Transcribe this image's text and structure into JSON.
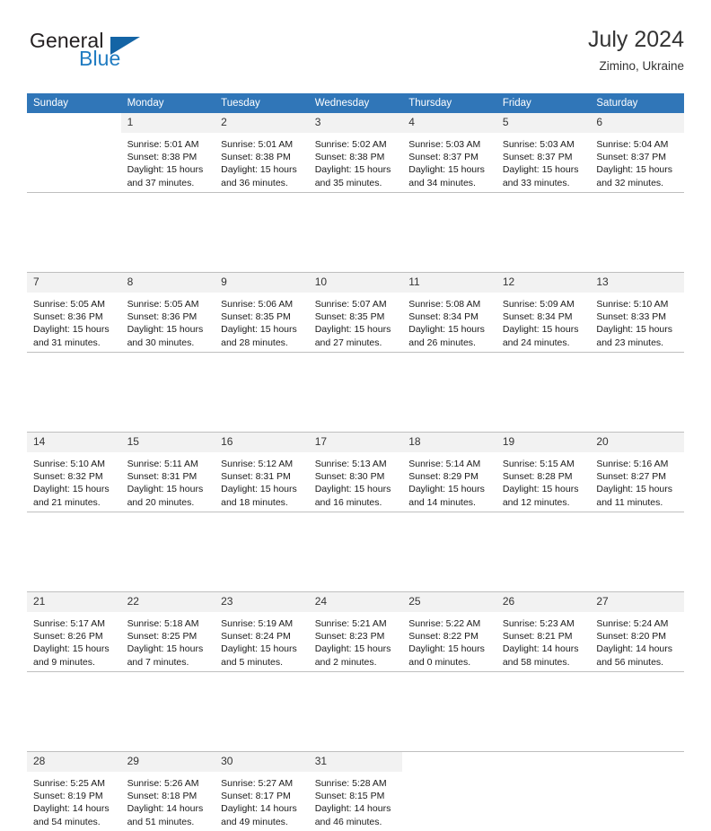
{
  "brand": {
    "name_part1": "General",
    "name_part2": "Blue",
    "logo_icon": "triangle-flag-icon"
  },
  "header": {
    "title": "July 2024",
    "subtitle": "Zimino, Ukraine"
  },
  "calendar": {
    "weekday_headers": [
      "Sunday",
      "Monday",
      "Tuesday",
      "Wednesday",
      "Thursday",
      "Friday",
      "Saturday"
    ],
    "colors": {
      "header_bg": "#3076b8",
      "header_text": "#ffffff",
      "daynum_bg": "#f2f2f2",
      "cell_border": "#bfbfbf",
      "brand_blue": "#1f7bc1",
      "logo_blue": "#1464a5"
    },
    "weeks": [
      [
        {
          "day": "",
          "empty": true
        },
        {
          "day": "1",
          "sunrise": "Sunrise: 5:01 AM",
          "sunset": "Sunset: 8:38 PM",
          "daylight_line1": "Daylight: 15 hours",
          "daylight_line2": "and 37 minutes."
        },
        {
          "day": "2",
          "sunrise": "Sunrise: 5:01 AM",
          "sunset": "Sunset: 8:38 PM",
          "daylight_line1": "Daylight: 15 hours",
          "daylight_line2": "and 36 minutes."
        },
        {
          "day": "3",
          "sunrise": "Sunrise: 5:02 AM",
          "sunset": "Sunset: 8:38 PM",
          "daylight_line1": "Daylight: 15 hours",
          "daylight_line2": "and 35 minutes."
        },
        {
          "day": "4",
          "sunrise": "Sunrise: 5:03 AM",
          "sunset": "Sunset: 8:37 PM",
          "daylight_line1": "Daylight: 15 hours",
          "daylight_line2": "and 34 minutes."
        },
        {
          "day": "5",
          "sunrise": "Sunrise: 5:03 AM",
          "sunset": "Sunset: 8:37 PM",
          "daylight_line1": "Daylight: 15 hours",
          "daylight_line2": "and 33 minutes."
        },
        {
          "day": "6",
          "sunrise": "Sunrise: 5:04 AM",
          "sunset": "Sunset: 8:37 PM",
          "daylight_line1": "Daylight: 15 hours",
          "daylight_line2": "and 32 minutes."
        }
      ],
      [
        {
          "day": "7",
          "sunrise": "Sunrise: 5:05 AM",
          "sunset": "Sunset: 8:36 PM",
          "daylight_line1": "Daylight: 15 hours",
          "daylight_line2": "and 31 minutes."
        },
        {
          "day": "8",
          "sunrise": "Sunrise: 5:05 AM",
          "sunset": "Sunset: 8:36 PM",
          "daylight_line1": "Daylight: 15 hours",
          "daylight_line2": "and 30 minutes."
        },
        {
          "day": "9",
          "sunrise": "Sunrise: 5:06 AM",
          "sunset": "Sunset: 8:35 PM",
          "daylight_line1": "Daylight: 15 hours",
          "daylight_line2": "and 28 minutes."
        },
        {
          "day": "10",
          "sunrise": "Sunrise: 5:07 AM",
          "sunset": "Sunset: 8:35 PM",
          "daylight_line1": "Daylight: 15 hours",
          "daylight_line2": "and 27 minutes."
        },
        {
          "day": "11",
          "sunrise": "Sunrise: 5:08 AM",
          "sunset": "Sunset: 8:34 PM",
          "daylight_line1": "Daylight: 15 hours",
          "daylight_line2": "and 26 minutes."
        },
        {
          "day": "12",
          "sunrise": "Sunrise: 5:09 AM",
          "sunset": "Sunset: 8:34 PM",
          "daylight_line1": "Daylight: 15 hours",
          "daylight_line2": "and 24 minutes."
        },
        {
          "day": "13",
          "sunrise": "Sunrise: 5:10 AM",
          "sunset": "Sunset: 8:33 PM",
          "daylight_line1": "Daylight: 15 hours",
          "daylight_line2": "and 23 minutes."
        }
      ],
      [
        {
          "day": "14",
          "sunrise": "Sunrise: 5:10 AM",
          "sunset": "Sunset: 8:32 PM",
          "daylight_line1": "Daylight: 15 hours",
          "daylight_line2": "and 21 minutes."
        },
        {
          "day": "15",
          "sunrise": "Sunrise: 5:11 AM",
          "sunset": "Sunset: 8:31 PM",
          "daylight_line1": "Daylight: 15 hours",
          "daylight_line2": "and 20 minutes."
        },
        {
          "day": "16",
          "sunrise": "Sunrise: 5:12 AM",
          "sunset": "Sunset: 8:31 PM",
          "daylight_line1": "Daylight: 15 hours",
          "daylight_line2": "and 18 minutes."
        },
        {
          "day": "17",
          "sunrise": "Sunrise: 5:13 AM",
          "sunset": "Sunset: 8:30 PM",
          "daylight_line1": "Daylight: 15 hours",
          "daylight_line2": "and 16 minutes."
        },
        {
          "day": "18",
          "sunrise": "Sunrise: 5:14 AM",
          "sunset": "Sunset: 8:29 PM",
          "daylight_line1": "Daylight: 15 hours",
          "daylight_line2": "and 14 minutes."
        },
        {
          "day": "19",
          "sunrise": "Sunrise: 5:15 AM",
          "sunset": "Sunset: 8:28 PM",
          "daylight_line1": "Daylight: 15 hours",
          "daylight_line2": "and 12 minutes."
        },
        {
          "day": "20",
          "sunrise": "Sunrise: 5:16 AM",
          "sunset": "Sunset: 8:27 PM",
          "daylight_line1": "Daylight: 15 hours",
          "daylight_line2": "and 11 minutes."
        }
      ],
      [
        {
          "day": "21",
          "sunrise": "Sunrise: 5:17 AM",
          "sunset": "Sunset: 8:26 PM",
          "daylight_line1": "Daylight: 15 hours",
          "daylight_line2": "and 9 minutes."
        },
        {
          "day": "22",
          "sunrise": "Sunrise: 5:18 AM",
          "sunset": "Sunset: 8:25 PM",
          "daylight_line1": "Daylight: 15 hours",
          "daylight_line2": "and 7 minutes."
        },
        {
          "day": "23",
          "sunrise": "Sunrise: 5:19 AM",
          "sunset": "Sunset: 8:24 PM",
          "daylight_line1": "Daylight: 15 hours",
          "daylight_line2": "and 5 minutes."
        },
        {
          "day": "24",
          "sunrise": "Sunrise: 5:21 AM",
          "sunset": "Sunset: 8:23 PM",
          "daylight_line1": "Daylight: 15 hours",
          "daylight_line2": "and 2 minutes."
        },
        {
          "day": "25",
          "sunrise": "Sunrise: 5:22 AM",
          "sunset": "Sunset: 8:22 PM",
          "daylight_line1": "Daylight: 15 hours",
          "daylight_line2": "and 0 minutes."
        },
        {
          "day": "26",
          "sunrise": "Sunrise: 5:23 AM",
          "sunset": "Sunset: 8:21 PM",
          "daylight_line1": "Daylight: 14 hours",
          "daylight_line2": "and 58 minutes."
        },
        {
          "day": "27",
          "sunrise": "Sunrise: 5:24 AM",
          "sunset": "Sunset: 8:20 PM",
          "daylight_line1": "Daylight: 14 hours",
          "daylight_line2": "and 56 minutes."
        }
      ],
      [
        {
          "day": "28",
          "sunrise": "Sunrise: 5:25 AM",
          "sunset": "Sunset: 8:19 PM",
          "daylight_line1": "Daylight: 14 hours",
          "daylight_line2": "and 54 minutes."
        },
        {
          "day": "29",
          "sunrise": "Sunrise: 5:26 AM",
          "sunset": "Sunset: 8:18 PM",
          "daylight_line1": "Daylight: 14 hours",
          "daylight_line2": "and 51 minutes."
        },
        {
          "day": "30",
          "sunrise": "Sunrise: 5:27 AM",
          "sunset": "Sunset: 8:17 PM",
          "daylight_line1": "Daylight: 14 hours",
          "daylight_line2": "and 49 minutes."
        },
        {
          "day": "31",
          "sunrise": "Sunrise: 5:28 AM",
          "sunset": "Sunset: 8:15 PM",
          "daylight_line1": "Daylight: 14 hours",
          "daylight_line2": "and 46 minutes."
        },
        {
          "day": "",
          "empty": true
        },
        {
          "day": "",
          "empty": true
        },
        {
          "day": "",
          "empty": true
        }
      ]
    ]
  }
}
